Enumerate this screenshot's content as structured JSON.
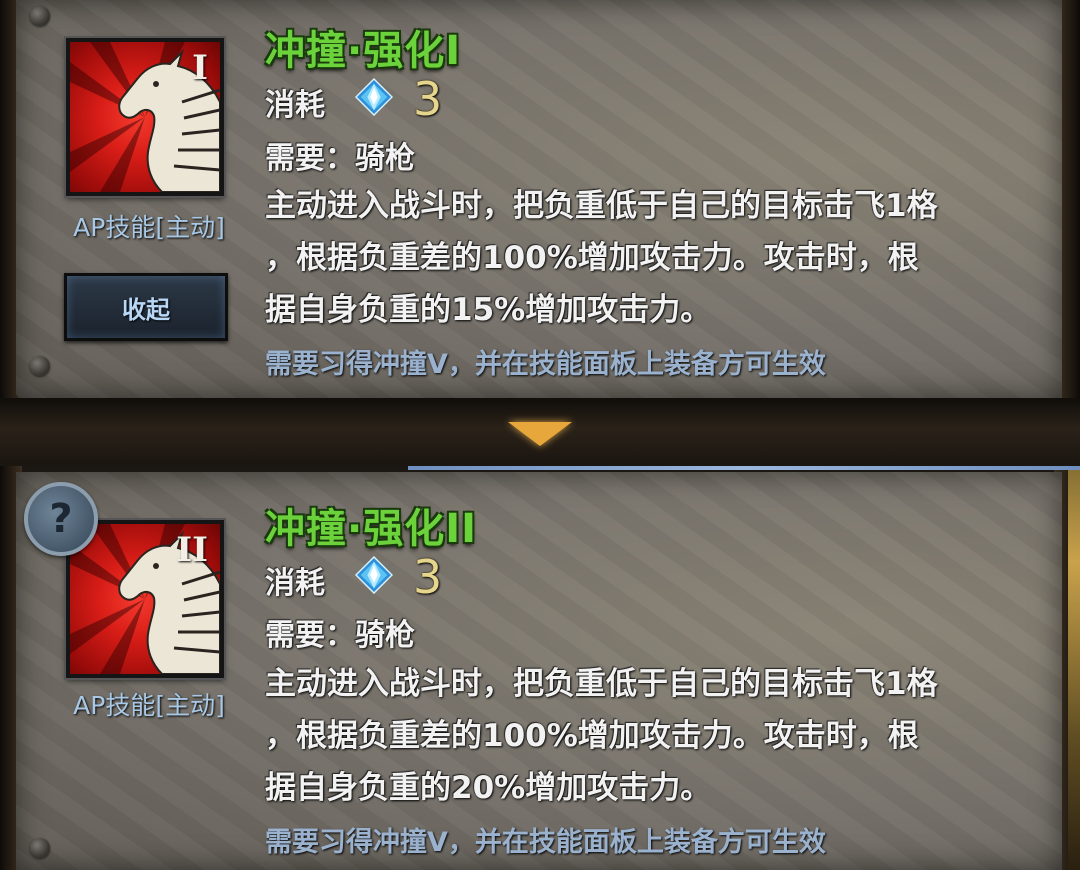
{
  "skills": [
    {
      "title": "冲撞·强化I",
      "roman": "I",
      "cost_label": "消耗",
      "cost_value": "3",
      "requirement": "需要：骑枪",
      "type_label": "AP技能[主动]",
      "description_lines": [
        "主动进入战斗时，把负重低于自己的目标击飞1格",
        "，根据负重差的100%增加攻击力。攻击时，根",
        "据自身负重的15%增加攻击力。"
      ],
      "note": "需要习得冲撞V，并在技能面板上装备方可生效",
      "collapse_label": "收起"
    },
    {
      "title": "冲撞·强化II",
      "roman": "II",
      "cost_label": "消耗",
      "cost_value": "3",
      "requirement": "需要：骑枪",
      "type_label": "AP技能[主动]",
      "description_lines": [
        "主动进入战斗时，把负重低于自己的目标击飞1格",
        "，根据负重差的100%增加攻击力。攻击时，根",
        "据自身负重的20%增加攻击力。"
      ],
      "note": "需要习得冲撞V，并在技能面板上装备方可生效",
      "help_label": "?"
    }
  ],
  "icons": {
    "skill": "horse-head-icon",
    "cost": "blue-diamond-gem-icon",
    "help": "question-mark-icon",
    "divider": "down-arrow-icon"
  },
  "colors": {
    "title": "#6bd23c",
    "note": "#9bb2cf",
    "type_label": "#a8c8e6",
    "cost_value": "#e6d58c",
    "icon_bg": "#d81d17"
  }
}
